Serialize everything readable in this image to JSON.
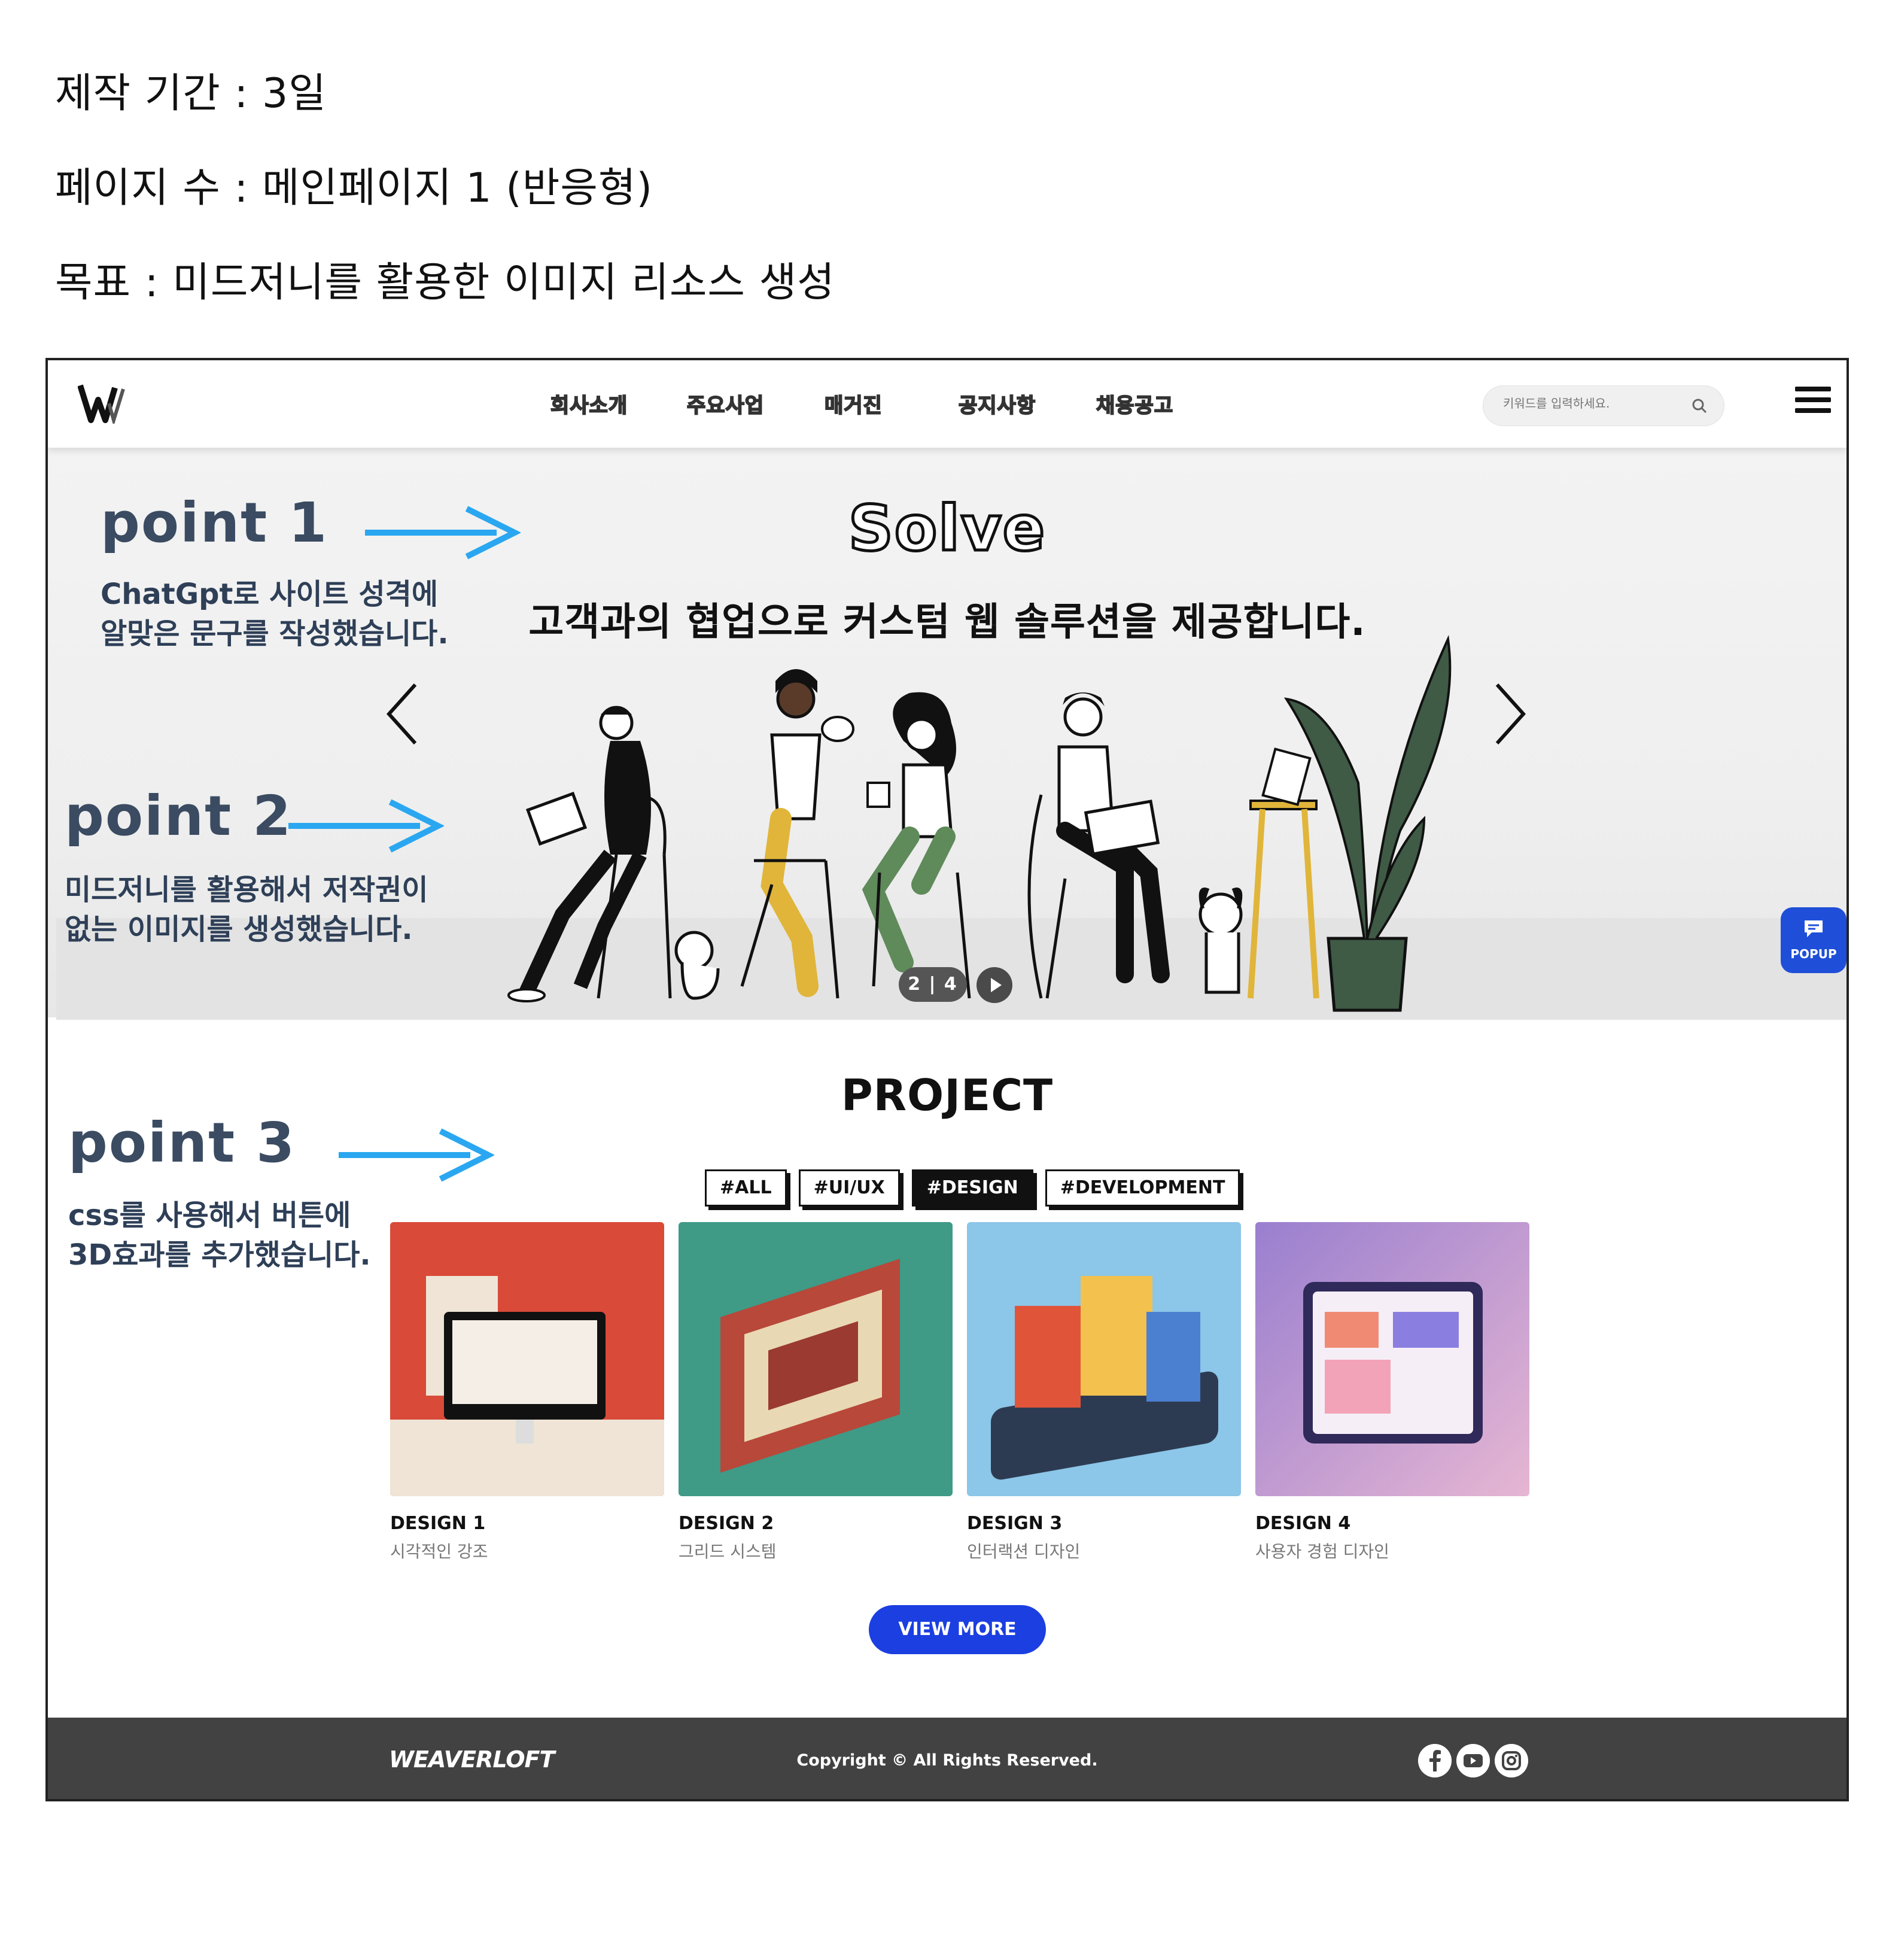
{
  "info": {
    "line1": "제작 기간 : 3일",
    "line2": "페이지 수 : 메인페이지 1 (반응형)",
    "line3": "목표 : 미드저니를 활용한 이미지 리소스 생성"
  },
  "header": {
    "nav": [
      "회사소개",
      "주요사업",
      "매거진",
      "공지사항",
      "채용공고"
    ],
    "search_placeholder": "키워드를 입력하세요."
  },
  "hero": {
    "title": "Solve",
    "subtitle": "고객과의 협업으로 커스텀 웹 솔루션을 제공합니다.",
    "pager": "2 | 4",
    "popup_label": "POPUP"
  },
  "project": {
    "title": "PROJECT",
    "filters": [
      "#ALL",
      "#UI/UX",
      "#DESIGN",
      "#DEVELOPMENT"
    ],
    "active_filter": "#DESIGN",
    "cards": [
      {
        "title": "DESIGN 1",
        "desc": "시각적인 강조"
      },
      {
        "title": "DESIGN 2",
        "desc": "그리드 시스템"
      },
      {
        "title": "DESIGN 3",
        "desc": "인터랙션 디자인"
      },
      {
        "title": "DESIGN 4",
        "desc": "사용자 경험 디자인"
      }
    ],
    "view_more": "VIEW MORE"
  },
  "footer": {
    "logo": "WEAVERLOFT",
    "copyright": "Copyright © All Rights Reserved.",
    "social": [
      "facebook-icon",
      "youtube-icon",
      "instagram-icon"
    ]
  },
  "annotations": [
    {
      "label": "point 1",
      "desc1": "ChatGpt로 사이트 성격에",
      "desc2": "알맞은 문구를 작성했습니다."
    },
    {
      "label": "point 2",
      "desc1": "미드저니를 활용해서 저작권이",
      "desc2": "없는 이미지를 생성했습니다."
    },
    {
      "label": "point 3",
      "desc1": "css를 사용해서 버튼에",
      "desc2": "3D효과를 추가했습니다."
    }
  ],
  "colors": {
    "accent_blue": "#1b3fe0",
    "annotation_arrow": "#2aa7f0",
    "annotation_text": "#2e3f57",
    "footer_bg": "#424242"
  }
}
